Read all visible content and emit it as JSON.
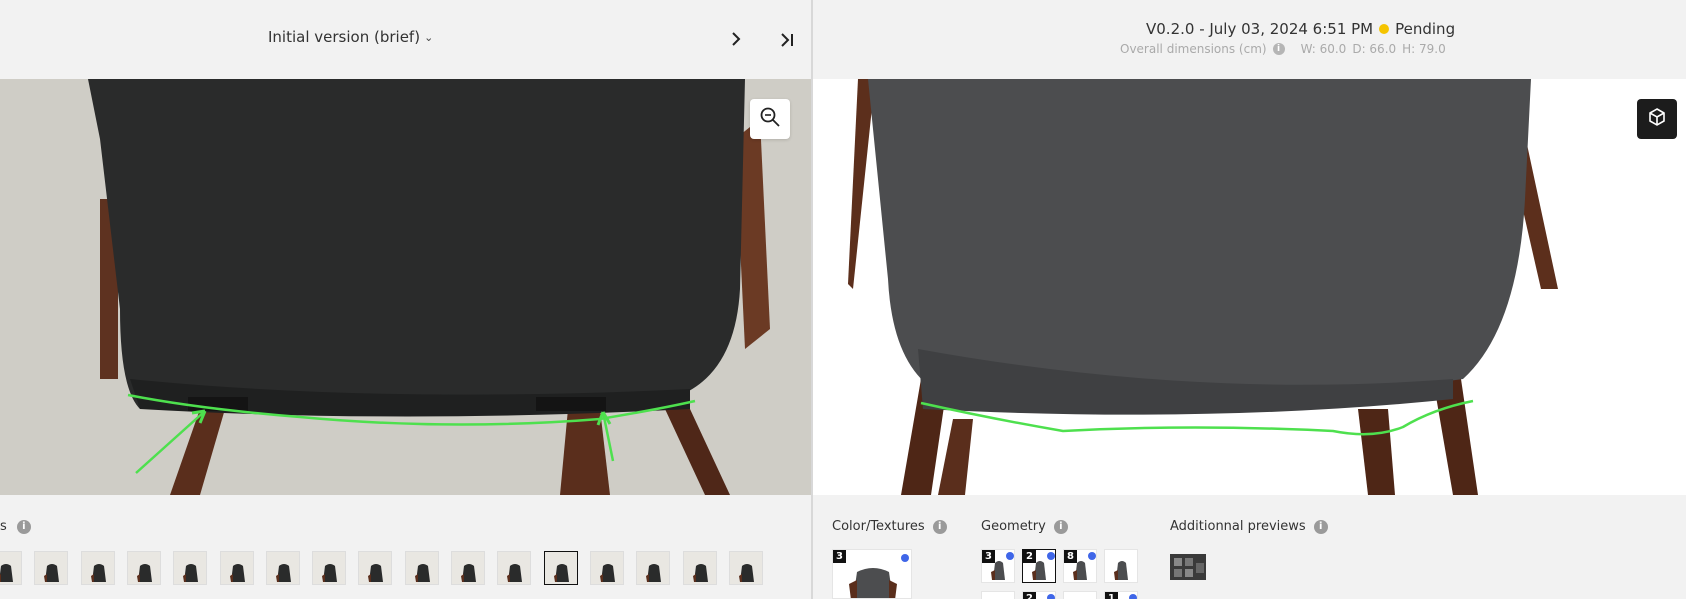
{
  "left": {
    "version_select_label": "Initial version (brief)",
    "images_label": "s",
    "thumb_count": 17,
    "selected_thumb_index": 12
  },
  "right": {
    "version_title": "V0.2.0 - July 03, 2024 6:51 PM",
    "status": "Pending",
    "status_color": "#f5c400",
    "dims_label": "Overall dimensions (cm)",
    "dims": {
      "w": "W: 60.0",
      "d": "D: 66.0",
      "h": "H: 79.0"
    },
    "sections": {
      "color_textures": {
        "label": "Color/Textures",
        "badge": "3"
      },
      "geometry": {
        "label": "Geometry",
        "badges": [
          "3",
          "2",
          "8",
          "",
          "",
          "2",
          "",
          "1"
        ]
      },
      "additional": {
        "label": "Additionnal previews"
      }
    }
  },
  "colors": {
    "annotation_green": "#4ee04e",
    "accent_blue": "#3f66e8",
    "chair_wood": "#5a2e1c"
  },
  "icons": {
    "next": "chevron-right-icon",
    "last": "skip-to-end-icon",
    "zoom": "zoom-out-icon",
    "view3d": "cube-icon",
    "info": "info-icon"
  }
}
